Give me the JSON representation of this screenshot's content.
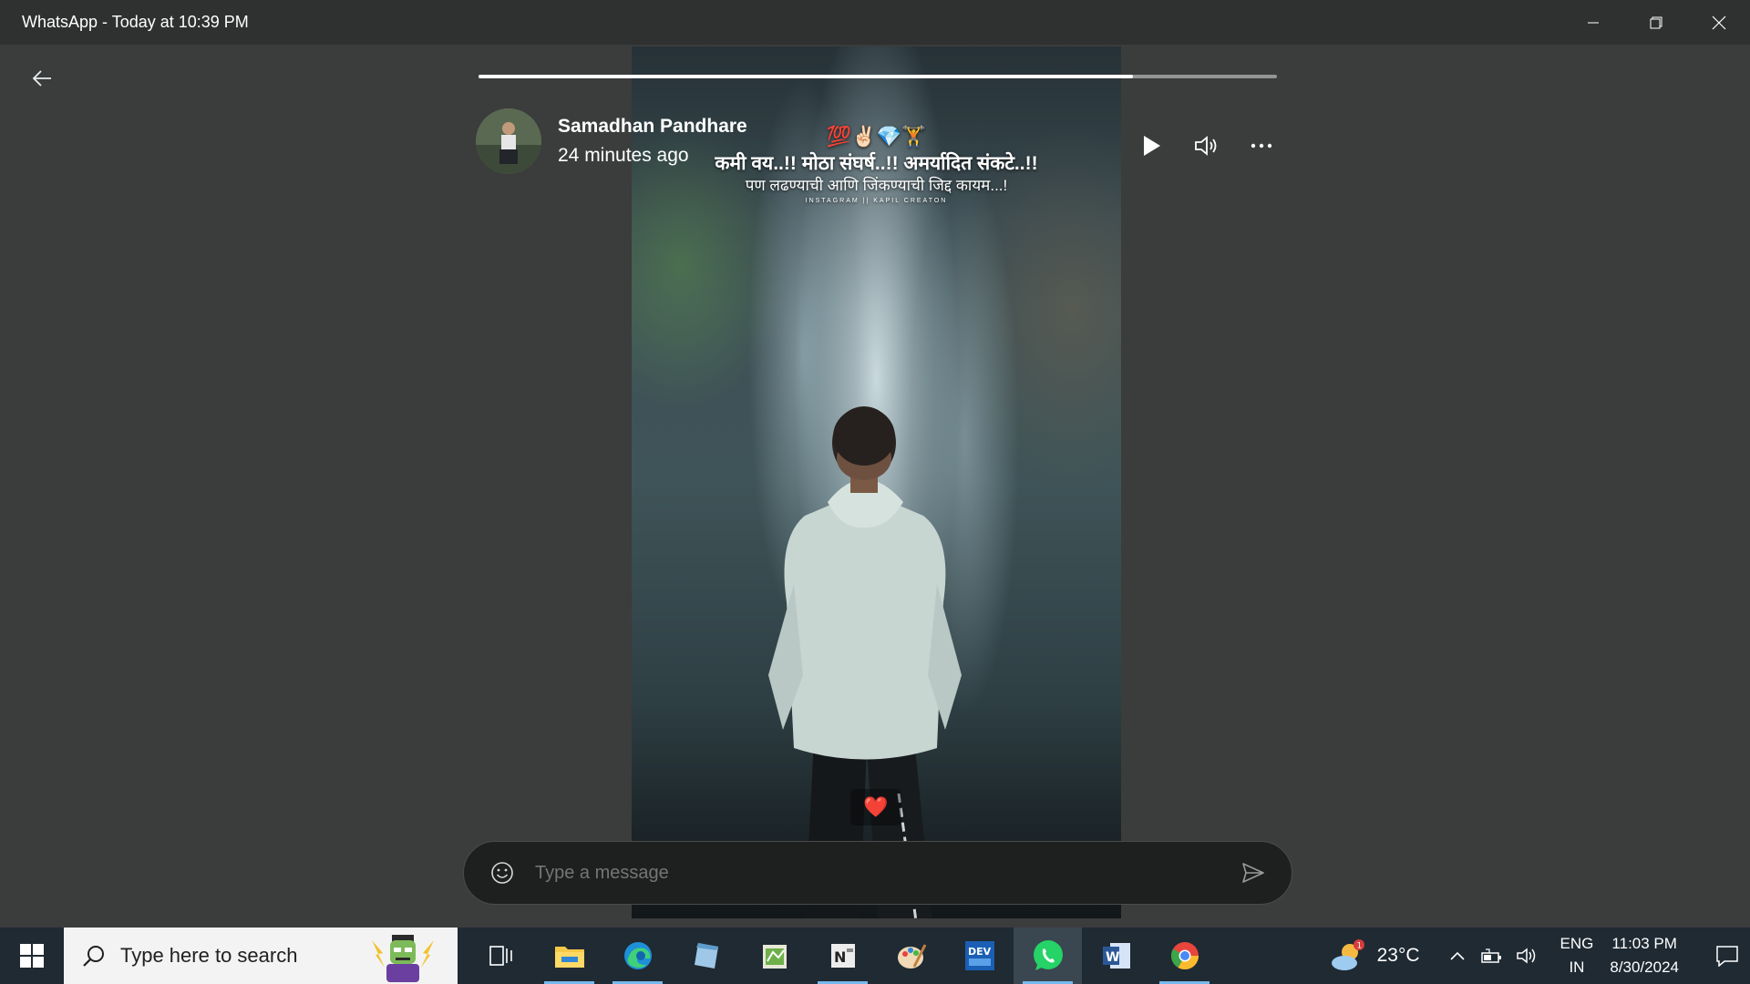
{
  "window": {
    "title": "WhatsApp - Today at 10:39 PM",
    "controls": [
      "minimize-icon",
      "restore-icon",
      "close-icon"
    ]
  },
  "status_viewer": {
    "progress_fraction": 0.82,
    "author": {
      "name": "Samadhan Pandhare",
      "time": "24 minutes ago"
    },
    "overlay_text": {
      "emoji_line": "💯✌🏻💎🏋",
      "line1": "कमी वय..!! मोठा संघर्ष..!! अमर्यादित संकटे..!!",
      "line2": "पण लढण्याची आणि जिंकण्याची जिद्द कायम...!",
      "credit": "INSTAGRAM || KAPIL CREATON"
    },
    "reaction": "❤️",
    "controls": [
      "play-icon",
      "volume-icon",
      "more-icon"
    ]
  },
  "composer": {
    "placeholder": "Type a message"
  },
  "taskbar": {
    "search_placeholder": "Type here to search",
    "apps": [
      {
        "name": "task-view",
        "active": false
      },
      {
        "name": "file-explorer",
        "active": false,
        "running": true
      },
      {
        "name": "edge",
        "active": false,
        "running": true
      },
      {
        "name": "notepad",
        "active": false
      },
      {
        "name": "excel-like",
        "active": false
      },
      {
        "name": "notepad-plus",
        "active": false,
        "running": true
      },
      {
        "name": "paint",
        "active": false
      },
      {
        "name": "dev-app",
        "active": false
      },
      {
        "name": "whatsapp",
        "active": true
      },
      {
        "name": "word",
        "active": false
      },
      {
        "name": "chrome",
        "active": false,
        "running": true
      }
    ],
    "weather": {
      "temp": "23°C",
      "badge": "1"
    },
    "lang": {
      "line1": "ENG",
      "line2": "IN"
    },
    "clock": {
      "time": "11:03 PM",
      "date": "8/30/2024"
    }
  }
}
